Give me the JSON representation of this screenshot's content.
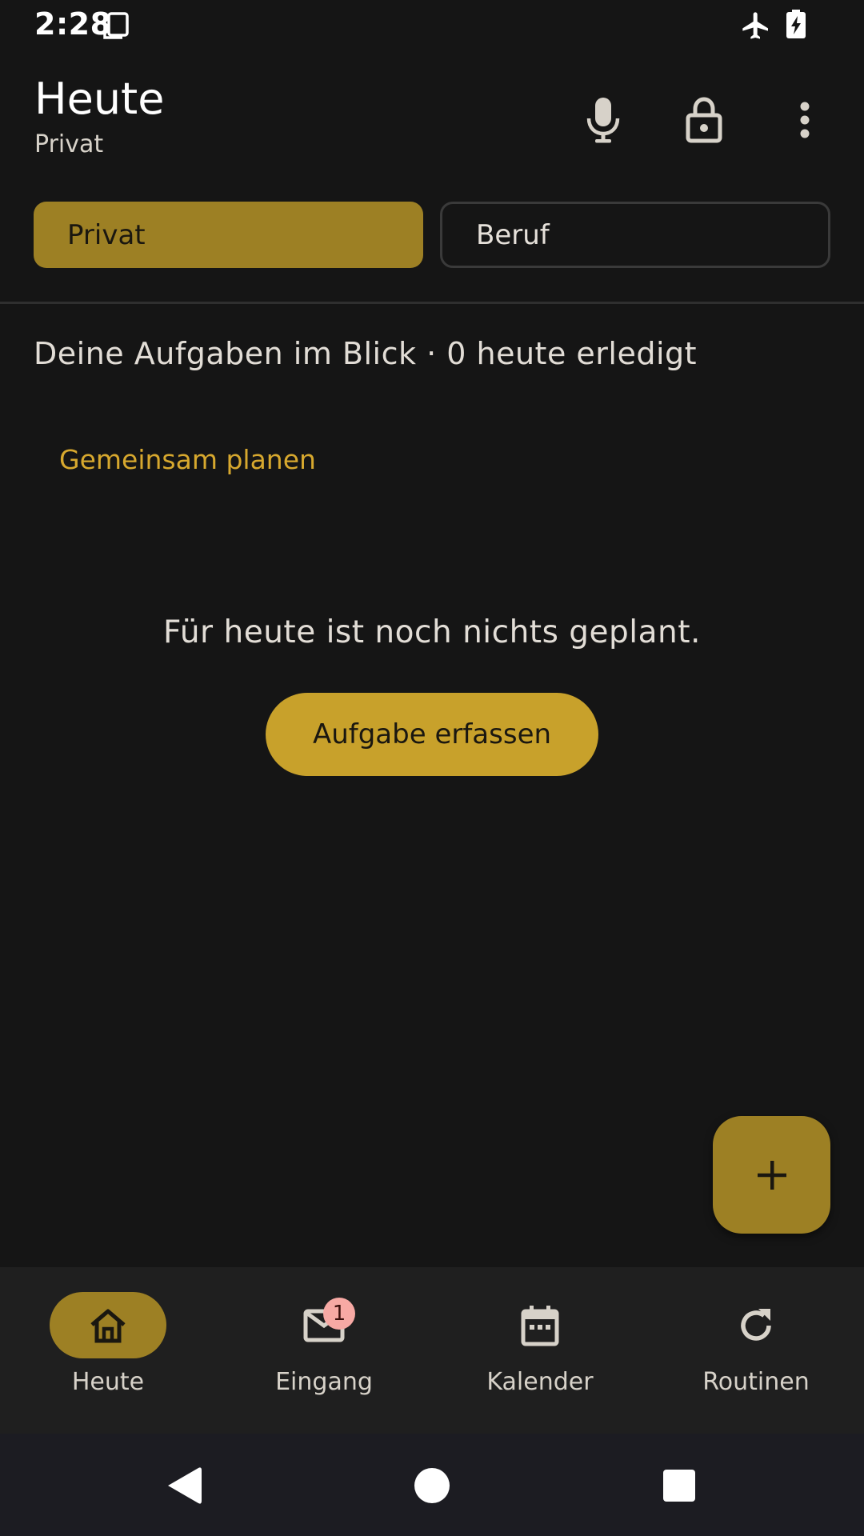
{
  "status_bar": {
    "time": "2:28",
    "icons": [
      "sim-card-icon",
      "airplane-mode-icon",
      "battery-charging-icon"
    ]
  },
  "header": {
    "title": "Heute",
    "subtitle": "Privat",
    "actions": [
      "microphone-icon",
      "lock-icon",
      "more-vert-icon"
    ]
  },
  "segments": {
    "privat": "Privat",
    "beruf": "Beruf",
    "selected": "Privat"
  },
  "summary": {
    "text": "Deine Aufgaben im Blick · 0 heute erledigt"
  },
  "shared": {
    "label": "Gemeinsam planen"
  },
  "empty_state": {
    "message": "Für heute ist noch nichts geplant.",
    "button_label": "Aufgabe erfassen"
  },
  "fab": {
    "icon": "plus-icon"
  },
  "bottom_nav": {
    "items": [
      {
        "label": "Heute",
        "icon": "home-icon",
        "active": true
      },
      {
        "label": "Eingang",
        "icon": "mail-icon",
        "badge": "1"
      },
      {
        "label": "Kalender",
        "icon": "calendar-icon"
      },
      {
        "label": "Routinen",
        "icon": "refresh-icon"
      }
    ]
  },
  "colors": {
    "background": "#151515",
    "accent": "#c8a12b",
    "accent_dark": "#9d8024",
    "badge": "#f7a9a4"
  }
}
